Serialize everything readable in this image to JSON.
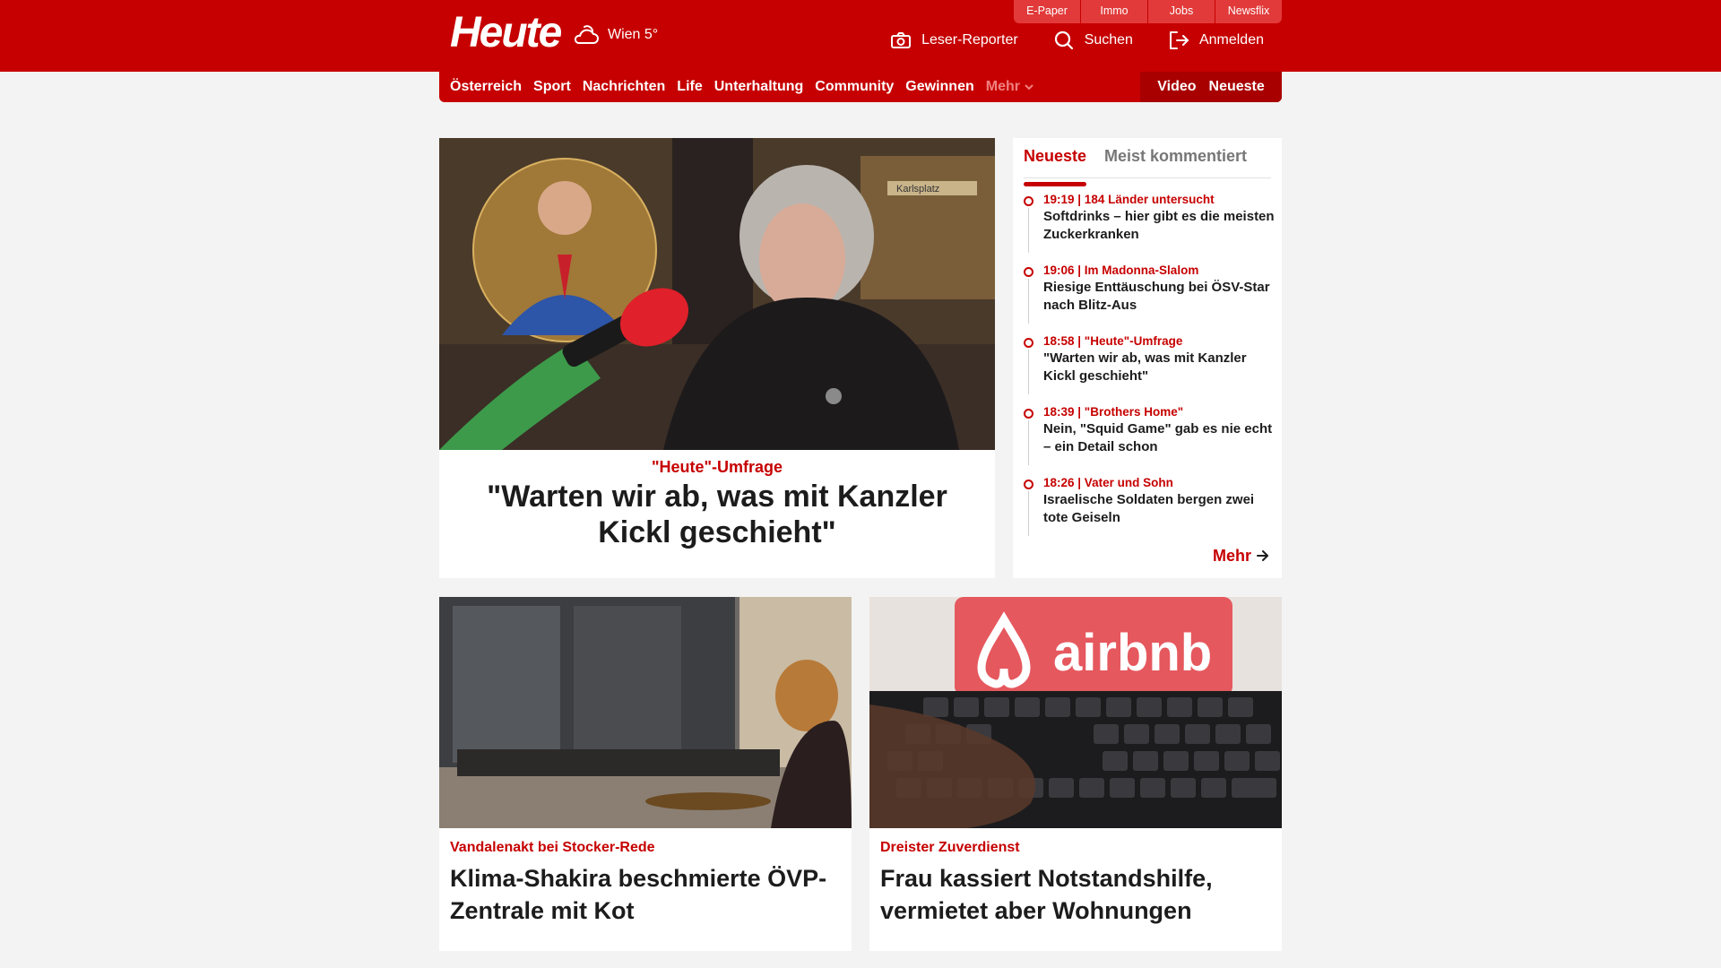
{
  "header": {
    "logo": "Heute",
    "weather": "Wien 5°",
    "util_tabs": [
      "E-Paper",
      "Immo",
      "Jobs",
      "Newsflix"
    ],
    "actions": {
      "reporter": "Leser-Reporter",
      "search": "Suchen",
      "login": "Anmelden"
    }
  },
  "nav": {
    "items": [
      "Österreich",
      "Sport",
      "Nachrichten",
      "Life",
      "Unterhaltung",
      "Community",
      "Gewinnen"
    ],
    "more": "Mehr",
    "right": [
      "Video",
      "Neueste"
    ]
  },
  "hero": {
    "kicker": "\"Heute\"-Umfrage",
    "title": "\"Warten wir ab, was mit Kanzler Kickl geschieht\"",
    "image_sign": "Karlsplatz"
  },
  "sidebar": {
    "tabs": [
      "Neueste",
      "Meist kommentiert"
    ],
    "items": [
      {
        "meta": "19:19 | 184 Länder untersucht",
        "title": "Softdrinks – hier gibt es die meisten Zuckerkranken"
      },
      {
        "meta": "19:06 | Im Madonna-Slalom",
        "title": "Riesige Enttäuschung bei ÖSV-Star nach Blitz-Aus"
      },
      {
        "meta": "18:58 | \"Heute\"-Umfrage",
        "title": "\"Warten wir ab, was mit Kanzler Kickl geschieht\""
      },
      {
        "meta": "18:39 | \"Brothers Home\"",
        "title": "Nein, \"Squid Game\" gab es nie echt – ein Detail schon"
      },
      {
        "meta": "18:26 | Vater und Sohn",
        "title": "Israelische Soldaten bergen zwei tote Geiseln"
      }
    ],
    "more": "Mehr"
  },
  "cards": [
    {
      "kicker": "Vandalenakt bei Stocker-Rede",
      "title": "Klima-Shakira beschmierte ÖVP-Zentrale mit Kot"
    },
    {
      "kicker": "Dreister Zuverdienst",
      "title": "Frau kassiert Notstandshilfe, vermietet aber Wohnungen",
      "image_text": "airbnb"
    }
  ],
  "colors": {
    "brand": "#c60000",
    "nav_dark": "#a80000",
    "background": "#f3f3f3"
  }
}
